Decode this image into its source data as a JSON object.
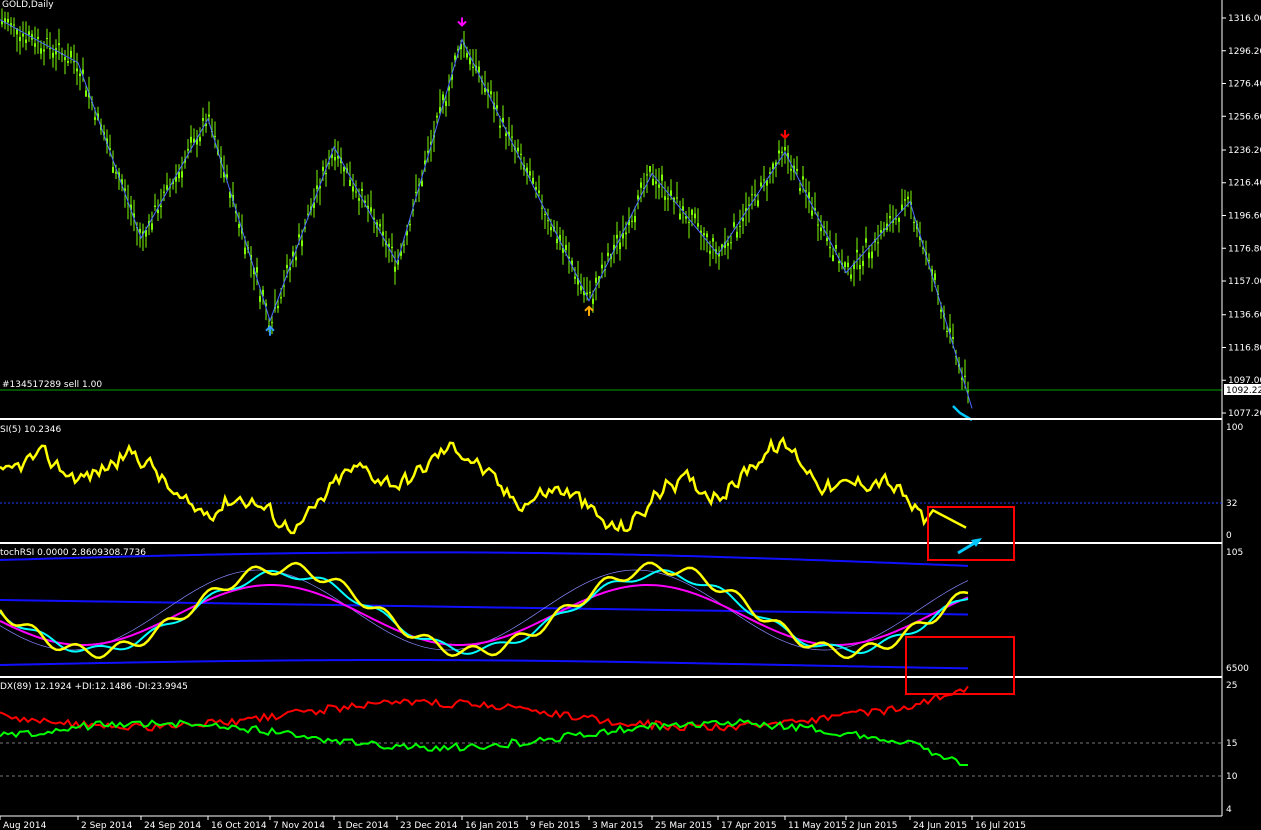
{
  "window": {
    "title": "GOLD,Daily",
    "order_label": "#134517289 sell 1.00",
    "current_price": "1092.22"
  },
  "colors": {
    "background": "#000000",
    "candle": "#7CFC00",
    "zigzag": "#4a6cff",
    "rsi_line": "#ffff00",
    "stoch_main": "#ffff00",
    "stoch_signal": "#00ffff",
    "stoch_ma": "#ff00ff",
    "stoch_band": "#0000ff",
    "adx_plus": "#00ff00",
    "adx_minus": "#ff0000",
    "order_line": "#00a000",
    "highlight_box": "#ff0000",
    "arrow_cyan": "#00c8ff"
  },
  "panels": {
    "rsi": {
      "label": "SI(5) 10.2346",
      "axis_labels": [
        "100",
        "32",
        "0"
      ]
    },
    "stoch_rsi": {
      "label": "tochRSI 0.0000 2.8609308.7736",
      "axis_labels": [
        "105",
        "6500"
      ]
    },
    "adx": {
      "label": "DX(89) 12.1924 +DI:12.1486 -DI:23.9945",
      "axis_labels": [
        "25",
        "15",
        "10",
        "4"
      ]
    }
  },
  "price_axis": [
    "1316.00",
    "1296.20",
    "1276.40",
    "1256.60",
    "1236.20",
    "1216.40",
    "1196.60",
    "1176.80",
    "1157.00",
    "1136.60",
    "1116.80",
    "1097.00",
    "1077.20"
  ],
  "date_axis": [
    "Aug 2014",
    "2 Sep 2014",
    "24 Sep 2014",
    "16 Oct 2014",
    "7 Nov 2014",
    "1 Dec 2014",
    "23 Dec 2014",
    "16 Jan 2015",
    "9 Feb 2015",
    "3 Mar 2015",
    "25 Mar 2015",
    "17 Apr 2015",
    "11 May 2015",
    "2 Jun 2015",
    "24 Jun 2015",
    "16 Jul 2015"
  ],
  "chart_data": {
    "type": "line",
    "title": "GOLD,Daily",
    "ylim": [
      1077.2,
      1316.0
    ],
    "zigzag_series": {
      "x": [
        "Aug 2014",
        "2 Sep 2014",
        "24 Sep 2014",
        "16 Oct 2014",
        "7 Nov 2014",
        "1 Dec 2014",
        "23 Dec 2014",
        "16 Jan 2015",
        "3 Mar 2015",
        "25 Mar 2015",
        "17 Apr 2015",
        "11 May 2015",
        "2 Jun 2015",
        "24 Jun 2015",
        "16 Jul 2015"
      ],
      "values": [
        1315,
        1289,
        1183,
        1255,
        1133,
        1238,
        1168,
        1303,
        1145,
        1222,
        1173,
        1235,
        1162,
        1205,
        1080
      ]
    },
    "signals": [
      {
        "date": "16 Jan 2015",
        "price": 1303,
        "type": "sell",
        "color": "#ff00ff"
      },
      {
        "date": "11 May 2015",
        "price": 1235,
        "type": "sell",
        "color": "#ff0000"
      },
      {
        "date": "7 Nov 2014",
        "price": 1133,
        "type": "buy",
        "color": "#3399ff"
      },
      {
        "date": "3 Mar 2015",
        "price": 1145,
        "type": "buy",
        "color": "#ffaa00"
      }
    ]
  }
}
